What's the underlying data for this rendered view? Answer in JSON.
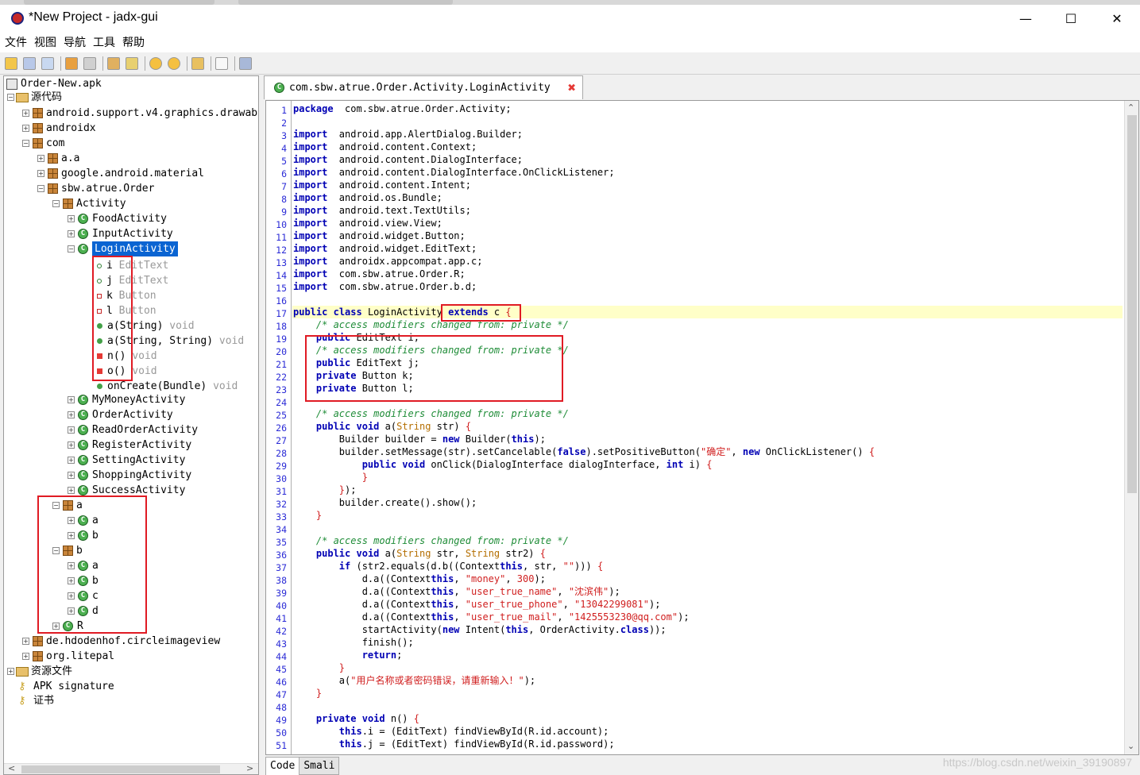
{
  "window": {
    "title": "*New Project - jadx-gui",
    "controls": {
      "minimize": "—",
      "maximize": "☐",
      "close": "✕"
    }
  },
  "menu": [
    "文件",
    "视图",
    "导航",
    "工具",
    "帮助"
  ],
  "toolbar": {
    "icons": [
      "open-file-icon",
      "add-files-icon",
      "save-project-icon",
      "sync-icon",
      "save-all-icon",
      "decompile-icon",
      "search-icon",
      "back-icon",
      "forward-icon",
      "deobfuscation-icon",
      "log-icon",
      "preferences-icon"
    ]
  },
  "tree": {
    "root": "Order-New.apk",
    "source_node": "源代码",
    "resources_node": "资源文件",
    "apk_signature": "APK signature",
    "certificate": "证书",
    "packages": {
      "android_support": "android.support.v4.graphics.drawable",
      "androidx": "androidx",
      "com": "com",
      "aa": "a.a",
      "google": "google.android.material",
      "sbw": "sbw.atrue.Order",
      "activity": "Activity",
      "pkg_a": "a",
      "pkg_b": "b",
      "de": "de.hdodenhof.circleimageview",
      "org": "org.litepal"
    },
    "activities_before": [
      "FoodActivity",
      "InputActivity"
    ],
    "selected": "LoginActivity",
    "members": [
      {
        "name": "i",
        "type": "EditText",
        "icon": "field-public"
      },
      {
        "name": "j",
        "type": "EditText",
        "icon": "field-public"
      },
      {
        "name": "k",
        "type": "Button",
        "icon": "field-private"
      },
      {
        "name": "l",
        "type": "Button",
        "icon": "field-private"
      },
      {
        "name": "a(String)",
        "type": "void",
        "icon": "method-public"
      },
      {
        "name": "a(String, String)",
        "type": "void",
        "icon": "method-public"
      },
      {
        "name": "n()",
        "type": "void",
        "icon": "method-private"
      },
      {
        "name": "o()",
        "type": "void",
        "icon": "method-private"
      },
      {
        "name": "onCreate(Bundle)",
        "type": "void",
        "icon": "method-public"
      }
    ],
    "activities_after": [
      "MyMoneyActivity",
      "OrderActivity",
      "ReadOrderActivity",
      "RegisterActivity",
      "SettingActivity",
      "ShoppingActivity",
      "SuccessActivity"
    ],
    "a_children": [
      "a",
      "b"
    ],
    "b_children": [
      "a",
      "b",
      "c",
      "d"
    ],
    "r_class": "R"
  },
  "editor": {
    "tab_title": "com.sbw.atrue.Order.Activity.LoginActivity",
    "tab_close": "✖",
    "bottom_tabs": [
      "Code",
      "Smali"
    ],
    "lines": [
      [
        [
          "kw",
          "package"
        ],
        [
          "",
          "  com.sbw.atrue.Order.Activity;"
        ]
      ],
      [],
      [
        [
          "kw",
          "import"
        ],
        [
          "",
          "  android.app.AlertDialog.Builder;"
        ]
      ],
      [
        [
          "kw",
          "import"
        ],
        [
          "",
          "  android.content.Context;"
        ]
      ],
      [
        [
          "kw",
          "import"
        ],
        [
          "",
          "  android.content.DialogInterface;"
        ]
      ],
      [
        [
          "kw",
          "import"
        ],
        [
          "",
          "  android.content.DialogInterface.OnClickListener;"
        ]
      ],
      [
        [
          "kw",
          "import"
        ],
        [
          "",
          "  android.content.Intent;"
        ]
      ],
      [
        [
          "kw",
          "import"
        ],
        [
          "",
          "  android.os.Bundle;"
        ]
      ],
      [
        [
          "kw",
          "import"
        ],
        [
          "",
          "  android.text.TextUtils;"
        ]
      ],
      [
        [
          "kw",
          "import"
        ],
        [
          "",
          "  android.view.View;"
        ]
      ],
      [
        [
          "kw",
          "import"
        ],
        [
          "",
          "  android.widget.Button;"
        ]
      ],
      [
        [
          "kw",
          "import"
        ],
        [
          "",
          "  android.widget.EditText;"
        ]
      ],
      [
        [
          "kw",
          "import"
        ],
        [
          "",
          "  androidx.appcompat.app.c;"
        ]
      ],
      [
        [
          "kw",
          "import"
        ],
        [
          "",
          "  com.sbw.atrue.Order.R;"
        ]
      ],
      [
        [
          "kw",
          "import"
        ],
        [
          "",
          "  com.sbw.atrue.Order.b.d;"
        ]
      ],
      [],
      [
        [
          "kw",
          "public"
        ],
        [
          "",
          " "
        ],
        [
          "kw",
          "class"
        ],
        [
          "",
          " LoginActivity "
        ],
        [
          "kw",
          "extends"
        ],
        [
          "",
          " c "
        ],
        [
          "st",
          "{"
        ]
      ],
      [
        [
          "",
          "    "
        ],
        [
          "cm",
          "/* access modifiers changed from: private */"
        ]
      ],
      [
        [
          "",
          "    "
        ],
        [
          "kw",
          "public"
        ],
        [
          "",
          " EditText i;"
        ]
      ],
      [
        [
          "",
          "    "
        ],
        [
          "cm",
          "/* access modifiers changed from: private */"
        ]
      ],
      [
        [
          "",
          "    "
        ],
        [
          "kw",
          "public"
        ],
        [
          "",
          " EditText j;"
        ]
      ],
      [
        [
          "",
          "    "
        ],
        [
          "kw",
          "private"
        ],
        [
          "",
          " Button k;"
        ]
      ],
      [
        [
          "",
          "    "
        ],
        [
          "kw",
          "private"
        ],
        [
          "",
          " Button l;"
        ]
      ],
      [],
      [
        [
          "",
          "    "
        ],
        [
          "cm",
          "/* access modifiers changed from: private */"
        ]
      ],
      [
        [
          "",
          "    "
        ],
        [
          "kw",
          "public"
        ],
        [
          "",
          " "
        ],
        [
          "kw",
          "void"
        ],
        [
          "",
          " a("
        ],
        [
          "ty",
          "String"
        ],
        [
          "",
          " str) "
        ],
        [
          "st",
          "{"
        ]
      ],
      [
        [
          "",
          "        Builder builder = "
        ],
        [
          "kw",
          "new"
        ],
        [
          "",
          " Builder("
        ],
        [
          "kw",
          "this"
        ],
        [
          "",
          ");"
        ]
      ],
      [
        [
          "",
          "        builder.setMessage(str).setCancelable("
        ],
        [
          "kw",
          "false"
        ],
        [
          "",
          ").setPositiveButton("
        ],
        [
          "st",
          "\"确定\""
        ],
        [
          "",
          ", "
        ],
        [
          "kw",
          "new"
        ],
        [
          "",
          " OnClickListener() "
        ],
        [
          "st",
          "{"
        ]
      ],
      [
        [
          "",
          "            "
        ],
        [
          "kw",
          "public"
        ],
        [
          "",
          " "
        ],
        [
          "kw",
          "void"
        ],
        [
          "",
          " onClick(DialogInterface dialogInterface, "
        ],
        [
          "kw",
          "int"
        ],
        [
          "",
          " i) "
        ],
        [
          "st",
          "{"
        ]
      ],
      [
        [
          "",
          "            "
        ],
        [
          "st",
          "}"
        ]
      ],
      [
        [
          "",
          "        "
        ],
        [
          "st",
          "}"
        ],
        [
          "",
          ");"
        ]
      ],
      [
        [
          "",
          "        builder.create().show();"
        ]
      ],
      [
        [
          "",
          "    "
        ],
        [
          "st",
          "}"
        ]
      ],
      [],
      [
        [
          "",
          "    "
        ],
        [
          "cm",
          "/* access modifiers changed from: private */"
        ]
      ],
      [
        [
          "",
          "    "
        ],
        [
          "kw",
          "public"
        ],
        [
          "",
          " "
        ],
        [
          "kw",
          "void"
        ],
        [
          "",
          " a("
        ],
        [
          "ty",
          "String"
        ],
        [
          "",
          " str, "
        ],
        [
          "ty",
          "String"
        ],
        [
          "",
          " str2) "
        ],
        [
          "st",
          "{"
        ]
      ],
      [
        [
          "",
          "        "
        ],
        [
          "kw",
          "if"
        ],
        [
          "",
          " (str2.equals(d.b(("
        ],
        [
          "",
          "Context"
        ],
        [
          ") "
        ],
        [
          "kw",
          "this"
        ],
        [
          "",
          ", str, "
        ],
        [
          "st",
          "\"\""
        ],
        [
          "",
          "))) "
        ],
        [
          "st",
          "{"
        ]
      ],
      [
        [
          "",
          "            d.a(("
        ],
        [
          "",
          "Context"
        ],
        [
          ") "
        ],
        [
          "kw",
          "this"
        ],
        [
          "",
          ", "
        ],
        [
          "st",
          "\"money\""
        ],
        [
          "",
          ", "
        ],
        [
          "st",
          "300"
        ],
        [
          "",
          ");"
        ]
      ],
      [
        [
          "",
          "            d.a(("
        ],
        [
          "",
          "Context"
        ],
        [
          ") "
        ],
        [
          "kw",
          "this"
        ],
        [
          "",
          ", "
        ],
        [
          "st",
          "\"user_true_name\""
        ],
        [
          "",
          ", "
        ],
        [
          "st",
          "\"沈滨伟\""
        ],
        [
          "",
          ");"
        ]
      ],
      [
        [
          "",
          "            d.a(("
        ],
        [
          "",
          "Context"
        ],
        [
          ") "
        ],
        [
          "kw",
          "this"
        ],
        [
          "",
          ", "
        ],
        [
          "st",
          "\"user_true_phone\""
        ],
        [
          "",
          ", "
        ],
        [
          "st",
          "\"13042299081\""
        ],
        [
          "",
          ");"
        ]
      ],
      [
        [
          "",
          "            d.a(("
        ],
        [
          "",
          "Context"
        ],
        [
          ") "
        ],
        [
          "kw",
          "this"
        ],
        [
          "",
          ", "
        ],
        [
          "st",
          "\"user_true_mail\""
        ],
        [
          "",
          ", "
        ],
        [
          "st",
          "\"1425553230@qq.com\""
        ],
        [
          "",
          ");"
        ]
      ],
      [
        [
          "",
          "            startActivity("
        ],
        [
          "kw",
          "new"
        ],
        [
          "",
          " Intent("
        ],
        [
          "kw",
          "this"
        ],
        [
          "",
          ", OrderActivity."
        ],
        [
          "kw",
          "class"
        ],
        [
          "",
          "));"
        ]
      ],
      [
        [
          "",
          "            finish();"
        ]
      ],
      [
        [
          "",
          "            "
        ],
        [
          "kw",
          "return"
        ],
        [
          "",
          ";"
        ]
      ],
      [
        [
          "",
          "        "
        ],
        [
          "st",
          "}"
        ]
      ],
      [
        [
          "",
          "        a("
        ],
        [
          "st",
          "\"用户名称或者密码错误，请重新输入！\""
        ],
        [
          "",
          ");"
        ]
      ],
      [
        [
          "",
          "    "
        ],
        [
          "st",
          "}"
        ]
      ],
      [],
      [
        [
          "",
          "    "
        ],
        [
          "kw",
          "private"
        ],
        [
          "",
          " "
        ],
        [
          "kw",
          "void"
        ],
        [
          "",
          " n() "
        ],
        [
          "st",
          "{"
        ]
      ],
      [
        [
          "",
          "        "
        ],
        [
          "kw",
          "this"
        ],
        [
          "",
          ".i = (EditText) findViewById(R.id.account);"
        ]
      ],
      [
        [
          "",
          "        "
        ],
        [
          "kw",
          "this"
        ],
        [
          "",
          ".j = (EditText) findViewById(R.id.password);"
        ]
      ]
    ]
  },
  "watermark": "https://blog.csdn.net/weixin_39190897"
}
